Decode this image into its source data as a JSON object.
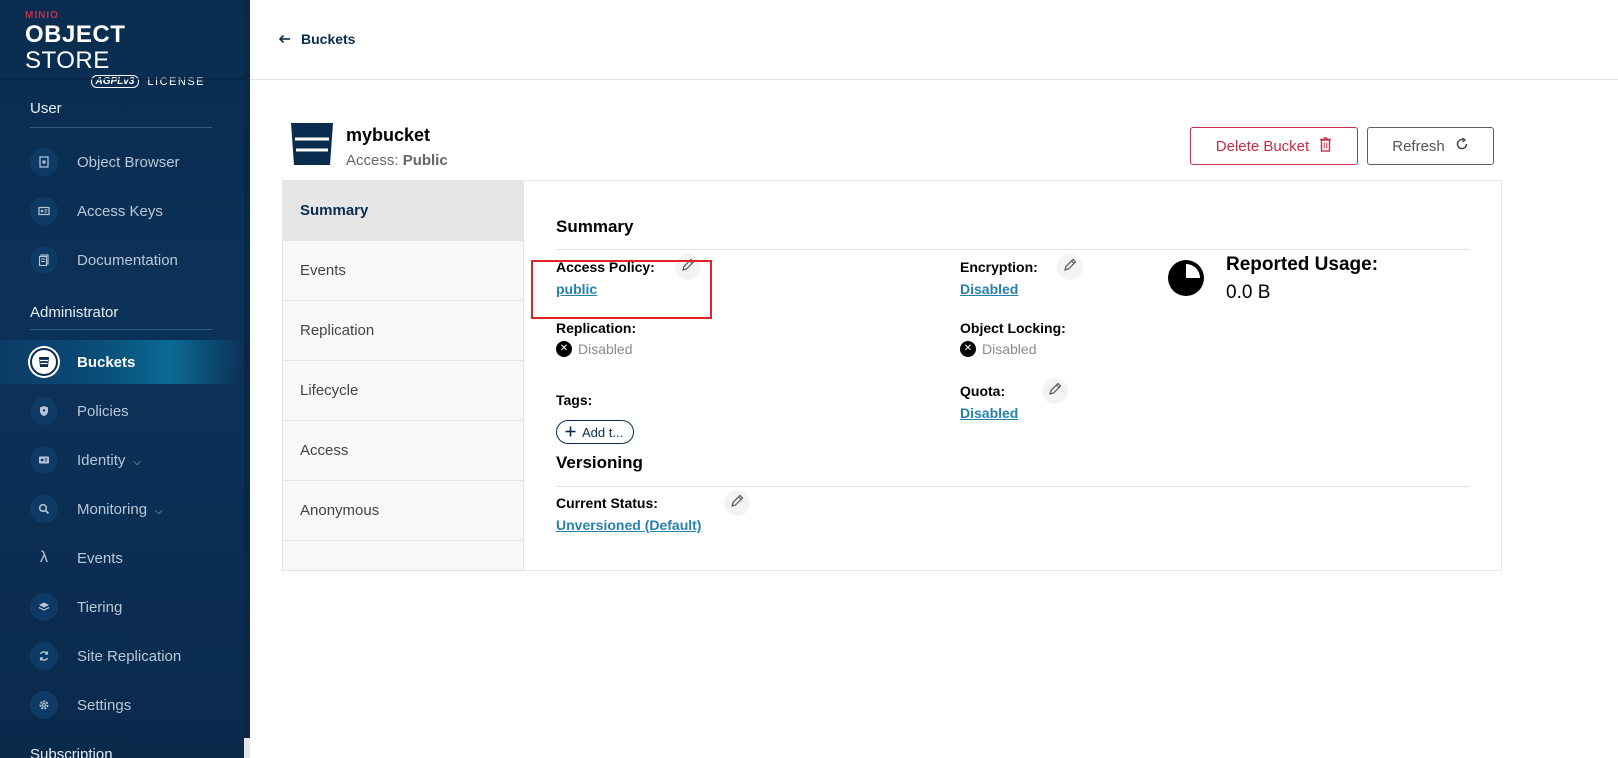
{
  "brand": {
    "minio": "MINIO",
    "title_bold": "OBJECT",
    "title_light": "STORE",
    "agpl": "AGPLv3",
    "license": "LICENSE"
  },
  "sidebar": {
    "user_section": "User",
    "user_items": [
      {
        "label": "Object Browser",
        "icon": "object-browser-icon"
      },
      {
        "label": "Access Keys",
        "icon": "access-keys-icon"
      },
      {
        "label": "Documentation",
        "icon": "documentation-icon"
      }
    ],
    "admin_section": "Administrator",
    "admin_items": [
      {
        "label": "Buckets",
        "icon": "bucket-icon",
        "active": true
      },
      {
        "label": "Policies",
        "icon": "policies-icon"
      },
      {
        "label": "Identity",
        "icon": "identity-icon",
        "expandable": true
      },
      {
        "label": "Monitoring",
        "icon": "monitoring-icon",
        "expandable": true
      },
      {
        "label": "Events",
        "icon": "lambda-icon"
      },
      {
        "label": "Tiering",
        "icon": "tiering-icon"
      },
      {
        "label": "Site Replication",
        "icon": "site-replication-icon"
      },
      {
        "label": "Settings",
        "icon": "settings-icon"
      }
    ],
    "subscription_section": "Subscription"
  },
  "topbar": {
    "back_label": "Buckets"
  },
  "bucket": {
    "name": "mybucket",
    "access_prefix": "Access:",
    "access_value": "Public",
    "delete_label": "Delete Bucket",
    "refresh_label": "Refresh"
  },
  "tabs": [
    "Summary",
    "Events",
    "Replication",
    "Lifecycle",
    "Access",
    "Anonymous"
  ],
  "summary": {
    "title": "Summary",
    "access_policy_label": "Access Policy:",
    "access_policy_value": "public",
    "encryption_label": "Encryption:",
    "encryption_value": "Disabled",
    "replication_label": "Replication:",
    "replication_value": "Disabled",
    "object_locking_label": "Object Locking:",
    "object_locking_value": "Disabled",
    "tags_label": "Tags:",
    "add_tag_label": "Add t...",
    "quota_label": "Quota:",
    "quota_value": "Disabled",
    "reported_usage_label": "Reported Usage:",
    "reported_usage_value": "0.0 B"
  },
  "versioning": {
    "title": "Versioning",
    "current_status_label": "Current Status:",
    "current_status_value": "Unversioned (Default)"
  },
  "colors": {
    "sidebar": "#0a2d4f",
    "accent_red": "#c72c48",
    "link_blue": "#2781b0",
    "highlight": "#e0222d"
  }
}
